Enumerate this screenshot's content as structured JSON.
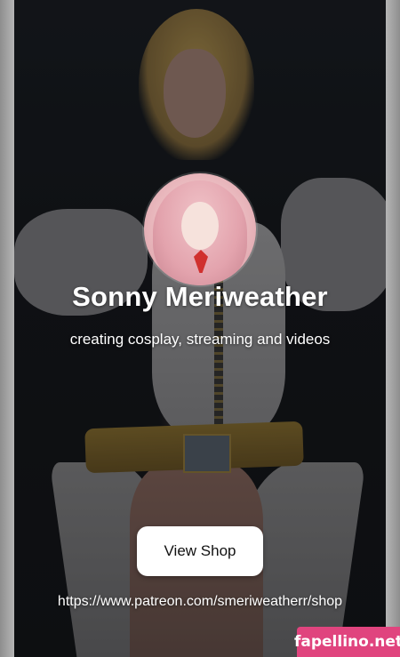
{
  "profile": {
    "name": "Sonny Meriweather",
    "tagline": "creating cosplay, streaming and videos"
  },
  "shop": {
    "button_label": "View Shop",
    "url_text": "https://www.patreon.com/smeriweatherr/shop"
  },
  "watermark": {
    "text": "fapellino.net"
  },
  "colors": {
    "watermark_bg": "#e0447e",
    "button_bg": "#ffffff",
    "text": "#ffffff"
  }
}
